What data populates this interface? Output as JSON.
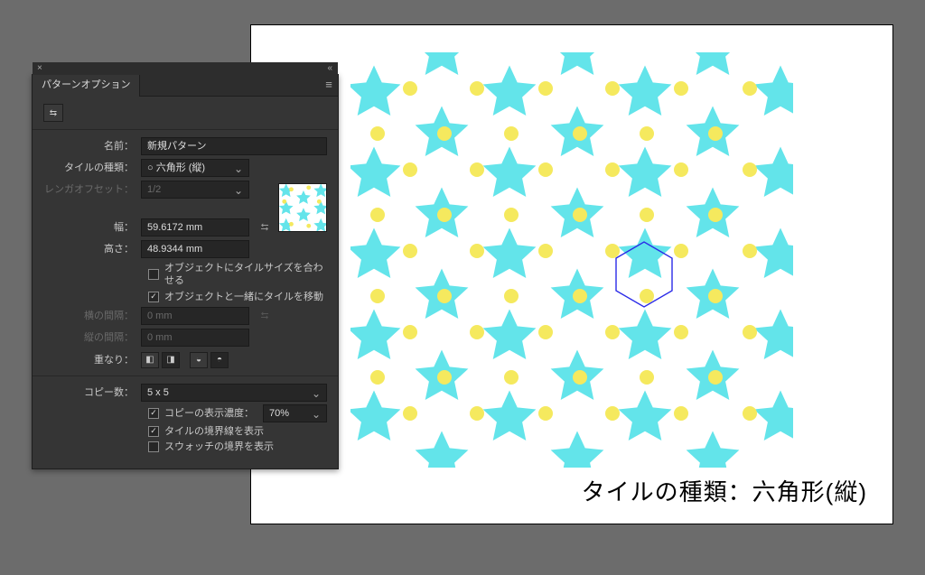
{
  "panel": {
    "title": "パターンオプション",
    "close_glyph": "×",
    "menu_glyph": "≡",
    "tool1_glyph": "⇆",
    "name_label": "名前：",
    "name_value": "新規パターン",
    "tiletype_label": "タイルの種類：",
    "tiletype_value": "○ 六角形 (縦)",
    "offset_label": "レンガオフセット：",
    "offset_value": "1/2",
    "width_label": "幅：",
    "width_value": "59.6172 mm",
    "height_label": "高さ：",
    "height_value": "48.9344 mm",
    "link_glyph": "⮀",
    "fit_to_obj_label": "オブジェクトにタイルサイズを合わせる",
    "move_with_obj_label": "オブジェクトと一緒にタイルを移動",
    "hgap_label": "横の間隔：",
    "hgap_value": "0 mm",
    "vgap_label": "縦の間隔：",
    "vgap_value": "0 mm",
    "link2_glyph": "⮀",
    "overlap_label": "重なり：",
    "ov1": "◧",
    "ov2": "◨",
    "ov3": "◒",
    "ov4": "◓",
    "copies_label": "コピー数：",
    "copies_value": "5 x 5",
    "opacity_label": "コピーの表示濃度：",
    "opacity_value": "70%",
    "show_tile_edge_label": "タイルの境界線を表示",
    "show_swatch_bounds_label": "スウォッチの境界を表示"
  },
  "canvas": {
    "caption": "タイルの種類：六角形(縦)"
  }
}
